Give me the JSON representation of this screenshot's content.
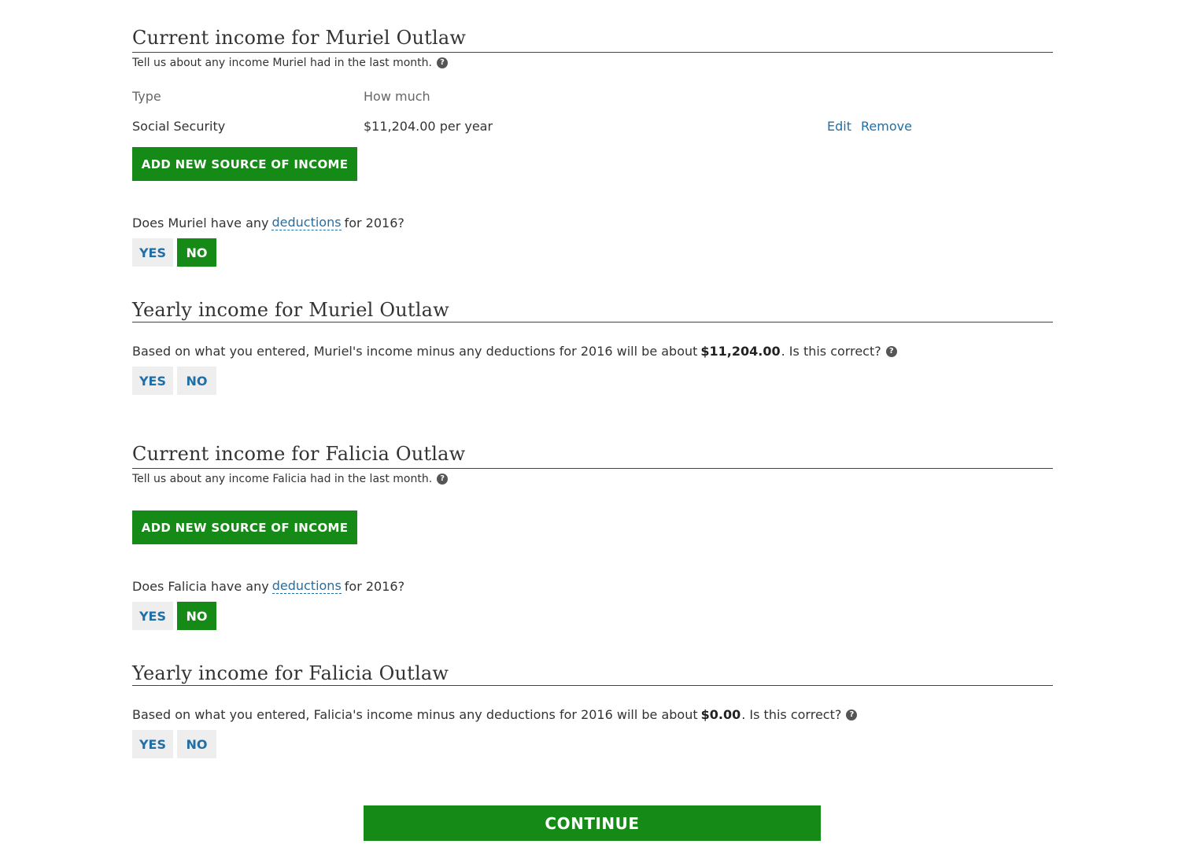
{
  "muriel_current": {
    "heading": "Current income for Muriel Outlaw",
    "subtext": "Tell us about any income Muriel had in the last month.",
    "columns": {
      "type": "Type",
      "amount": "How much"
    },
    "rows": [
      {
        "type": "Social Security",
        "amount": "$11,204.00 per year",
        "edit": "Edit",
        "remove": "Remove"
      }
    ],
    "add_button": "ADD NEW SOURCE OF INCOME",
    "deductions_question": {
      "before": "Does Muriel have any",
      "link": "deductions",
      "after": "for 2016?"
    },
    "yes": "YES",
    "no": "NO",
    "selected": "NO"
  },
  "muriel_yearly": {
    "heading": "Yearly income for Muriel Outlaw",
    "text_before": "Based on what you entered, Muriel's income minus any deductions for 2016 will be about",
    "amount": "$11,204.00",
    "text_after": ". Is this correct?",
    "yes": "YES",
    "no": "NO",
    "selected": null
  },
  "falicia_current": {
    "heading": "Current income for Falicia Outlaw",
    "subtext": "Tell us about any income Falicia had in the last month.",
    "add_button": "ADD NEW SOURCE OF INCOME",
    "deductions_question": {
      "before": "Does Falicia have any",
      "link": "deductions",
      "after": "for 2016?"
    },
    "yes": "YES",
    "no": "NO",
    "selected": "NO"
  },
  "falicia_yearly": {
    "heading": "Yearly income for Falicia Outlaw",
    "text_before": "Based on what you entered, Falicia's income minus any deductions for 2016 will be about",
    "amount": "$0.00",
    "text_after": ". Is this correct?",
    "yes": "YES",
    "no": "NO",
    "selected": null
  },
  "continue_button": "CONTINUE",
  "colors": {
    "primary_green": "#168a16",
    "link_blue": "#1f6fa8",
    "button_gray": "#eeeeee"
  },
  "icons": {
    "help": "question-circle-icon"
  }
}
